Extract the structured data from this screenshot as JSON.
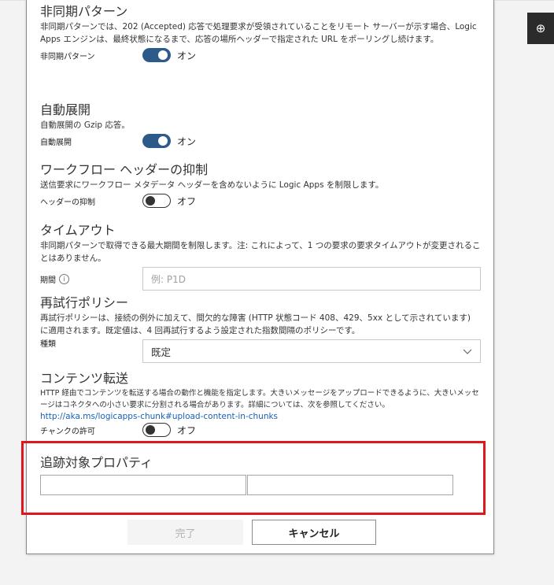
{
  "zoom": {
    "icon": "zoom-in-icon",
    "glyph": "⊕"
  },
  "sections": {
    "async": {
      "title": "非同期パターン",
      "desc": "非同期パターンでは、202 (Accepted) 応答で処理要求が受領されていることをリモート サーバーが示す場合、Logic Apps エンジンは、最終状態になるまで、応答の場所ヘッダーで指定された URL をポーリングし続けます。",
      "label": "非同期パターン",
      "state": "オン"
    },
    "decompress": {
      "title": "自動展開",
      "desc": "自動展開の Gzip 応答。",
      "label": "自動展開",
      "state": "オン"
    },
    "suppress_headers": {
      "title": "ワークフロー ヘッダーの抑制",
      "desc": "送信要求にワークフロー メタデータ ヘッダーを含めないように Logic Apps を制限します。",
      "label": "ヘッダーの抑制",
      "state": "オフ"
    },
    "timeout": {
      "title": "タイムアウト",
      "desc": "非同期パターンで取得できる最大期間を制限します。注: これによって、1 つの要求の要求タイムアウトが変更されることはありません。",
      "label": "期間",
      "placeholder": "例: P1D"
    },
    "retry": {
      "title": "再試行ポリシー",
      "desc": "再試行ポリシーは、接続の例外に加えて、間欠的な障害 (HTTP 状態コード 408、429、5xx として示されています) に適用されます。既定値は、4 回再試行するよう設定された指数間隔のポリシーです。",
      "label": "種類",
      "value": "既定"
    },
    "chunking": {
      "title": "コンテンツ転送",
      "desc": "HTTP 経由でコンテンツを転送する場合の動作と機能を指定します。大きいメッセージをアップロードできるように、大きいメッセージはコネクタへの小さい要求に分割される場合があります。詳細については、次を参照してください。",
      "link": "http://aka.ms/logicapps-chunk#upload-content-in-chunks",
      "label": "チャンクの許可",
      "state": "オフ"
    }
  },
  "tracked": {
    "title": "追跡対象プロパティ"
  },
  "footer": {
    "done": "完了",
    "cancel": "キャンセル"
  },
  "colors": {
    "toggle_on": "#2c5a8a",
    "highlight": "#e0161c",
    "link": "#1a5fb4"
  }
}
